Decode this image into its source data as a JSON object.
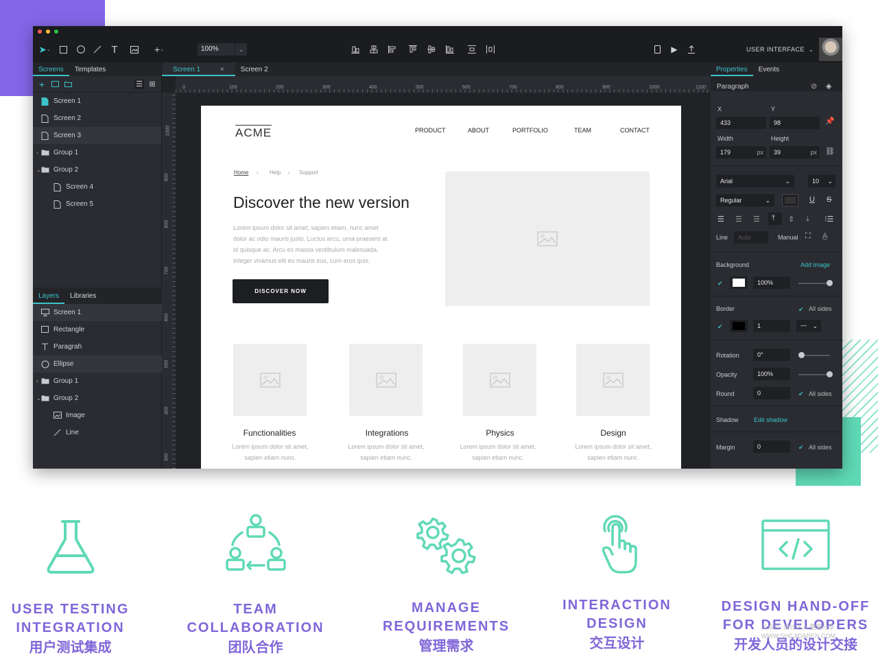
{
  "colors": {
    "accent": "#3bc4c9",
    "purple": "#7f66d8",
    "teal": "#5fd9b5"
  },
  "toolbar": {
    "zoom": "100%",
    "user_label": "USER INTERFACE"
  },
  "left": {
    "screen_tabs": [
      "Screens",
      "Templates"
    ],
    "screens": [
      {
        "label": "Screen 1",
        "indent": 0
      },
      {
        "label": "Screen 2",
        "indent": 0
      },
      {
        "label": "Screen 3",
        "indent": 0
      },
      {
        "label": "Group 1",
        "indent": 0
      },
      {
        "label": "Group 2",
        "indent": 0
      },
      {
        "label": "Screen 4",
        "indent": 1
      },
      {
        "label": "Screen 5",
        "indent": 1
      }
    ],
    "layer_tabs": [
      "Layers",
      "Libraries"
    ],
    "layers": [
      {
        "label": "Screen 1",
        "indent": 0
      },
      {
        "label": "Rectangle",
        "indent": 0
      },
      {
        "label": "Paragrah",
        "indent": 0
      },
      {
        "label": "Ellipse",
        "indent": 0
      },
      {
        "label": "Group 1",
        "indent": 0
      },
      {
        "label": "Group 2",
        "indent": 0
      },
      {
        "label": "Image",
        "indent": 1
      },
      {
        "label": "Line",
        "indent": 1
      }
    ]
  },
  "center": {
    "tabs": [
      "Screen 1",
      "Screen 2"
    ],
    "hruler": [
      "0",
      "100",
      "200",
      "300",
      "400",
      "500",
      "600",
      "700",
      "800",
      "900",
      "1000",
      "1100"
    ],
    "vruler": [
      "1000",
      "900",
      "800",
      "700",
      "600",
      "500",
      "400",
      "300"
    ]
  },
  "canvas": {
    "logo": "ACME",
    "nav": [
      "PRODUCT",
      "ABOUT",
      "PORTFOLIO",
      "TEAM",
      "CONTACT"
    ],
    "breadcrumb": [
      "Home",
      "Help",
      "Support"
    ],
    "hero_title": "Discover the new version",
    "hero_text_lines": [
      "Lorem ipsum dolor sit amet, sapien etiam, nunc amet",
      "dolor ac odio mauris justo. Luctus arcu, urna praesent at",
      "id quisque ac. Arcu es massa vestibulum malesuada,",
      "integer vivamus elit eu mauris eus, cum eros quis."
    ],
    "cta": "DISCOVER NOW",
    "features": [
      {
        "title": "Functionalities",
        "desc1": "Lorem ipsum dolor sit amet,",
        "desc2": "sapien etiam nunc."
      },
      {
        "title": "Integrations",
        "desc1": "Lorem ipsum dolor sit amet,",
        "desc2": "sapien etiam nunc."
      },
      {
        "title": "Physics",
        "desc1": "Lorem ipsum dolor sit amet,",
        "desc2": "sapien etiam nunc."
      },
      {
        "title": "Design",
        "desc1": "Lorem ipsum dolor sit amet,",
        "desc2": "sapien etiam nunc."
      }
    ]
  },
  "right": {
    "tabs": [
      "Properties",
      "Events"
    ],
    "section": "Paragraph",
    "x_label": "X",
    "y_label": "Y",
    "x": "433",
    "y": "98",
    "w_label": "Width",
    "h_label": "Height",
    "w": "179",
    "h": "39",
    "unit": "px",
    "font": "Arial",
    "font_size": "10",
    "weight": "Regular",
    "line_label": "Line",
    "line_value": "Auto",
    "manual_label": "Manual",
    "bg_label": "Background",
    "add_image": "Add image",
    "bg_opacity": "100%",
    "border_label": "Border",
    "all_sides": "All sides",
    "border_value": "1",
    "rotation_label": "Rotation",
    "rotation": "0°",
    "opacity_label": "Opacity",
    "opacity": "100%",
    "round_label": "Round",
    "round": "0",
    "shadow_label": "Shadow",
    "edit_shadow": "Edit shadow",
    "margin_label": "Margin",
    "margin": "0"
  },
  "features": [
    {
      "icon": "flask-icon",
      "en": [
        "USER TESTING",
        "INTEGRATION"
      ],
      "zh": "用户测试集成"
    },
    {
      "icon": "team-icon",
      "en": [
        "TEAM",
        "COLLABORATION"
      ],
      "zh": "团队合作"
    },
    {
      "icon": "gears-icon",
      "en": [
        "MANAGE",
        "REQUIREMENTS"
      ],
      "zh": "管理需求"
    },
    {
      "icon": "tap-icon",
      "en": [
        "INTERACTION",
        "DESIGN"
      ],
      "zh": "交互设计"
    },
    {
      "icon": "code-window-icon",
      "en": [
        "DESIGN HAND-OFF",
        "FOR DEVELOPERS"
      ],
      "zh": "开发人员的设计交接"
    }
  ],
  "watermark": [
    "公众号: 设计达人 整理分享",
    "WWW.SHEJIDAREN.COM"
  ]
}
